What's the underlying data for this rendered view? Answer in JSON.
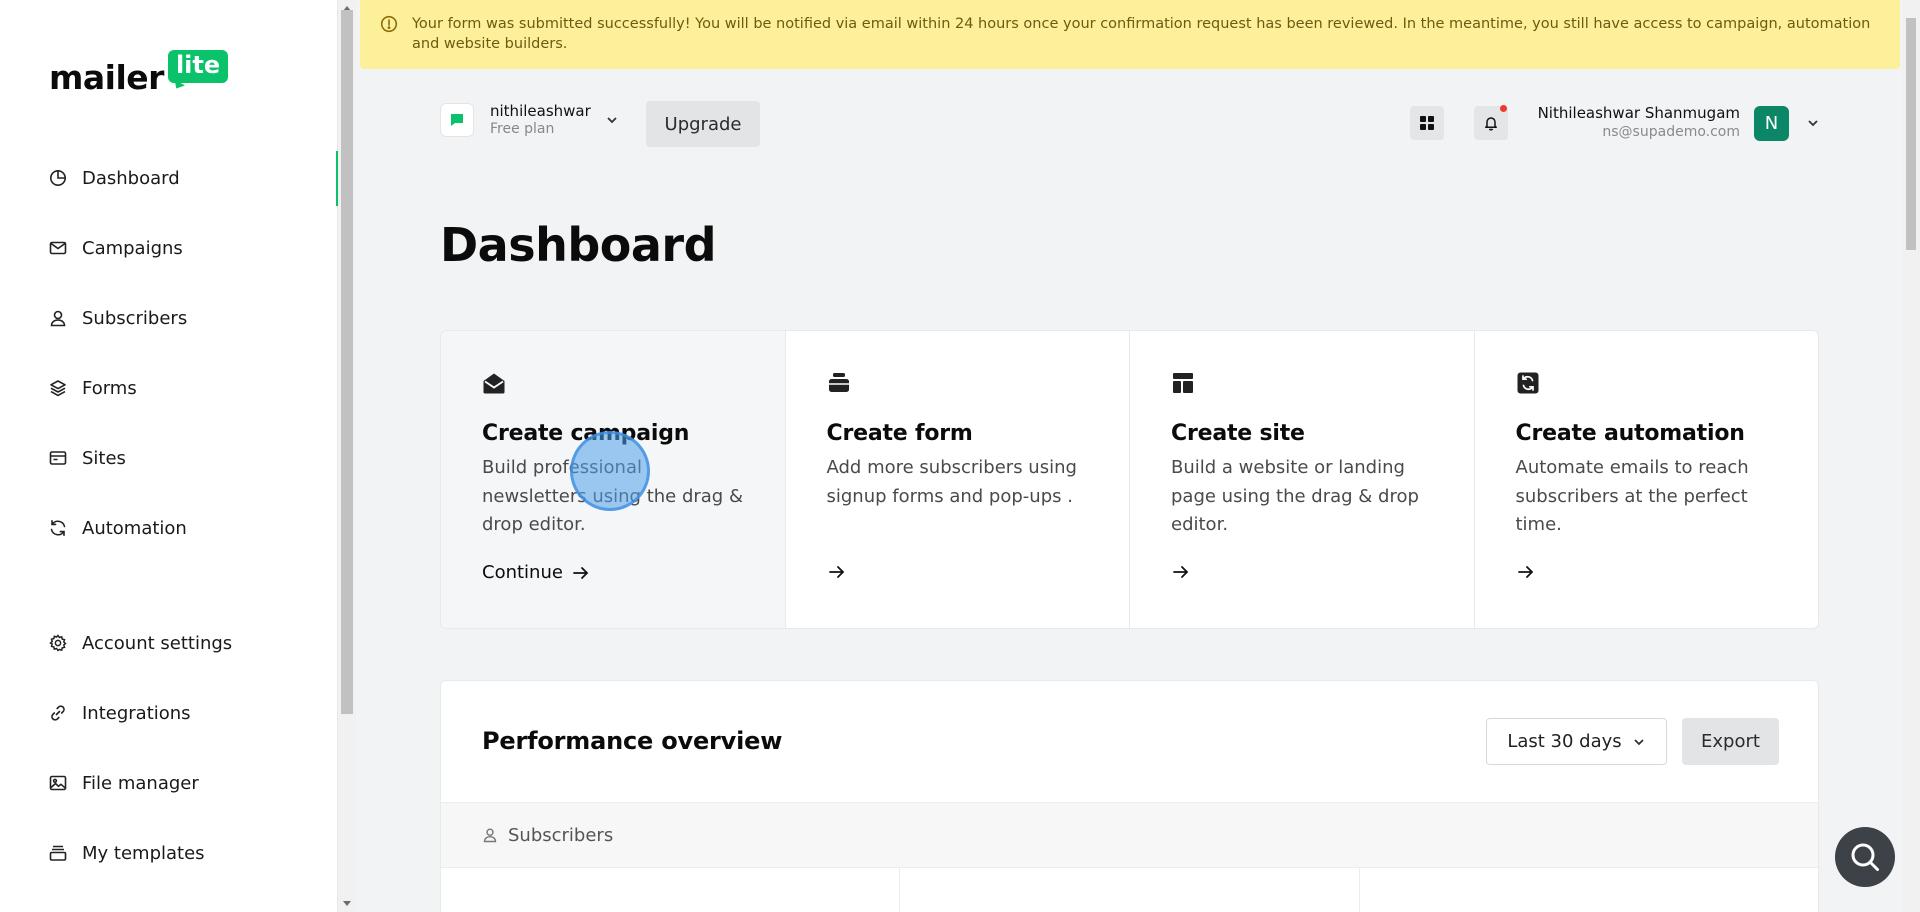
{
  "brand": {
    "word": "mailer",
    "badge": "lite",
    "accent": "#09c269"
  },
  "sidebar": {
    "items": [
      {
        "label": "Dashboard",
        "icon": "dashboard-icon",
        "active": true
      },
      {
        "label": "Campaigns",
        "icon": "envelope-icon"
      },
      {
        "label": "Subscribers",
        "icon": "user-icon"
      },
      {
        "label": "Forms",
        "icon": "layers-icon"
      },
      {
        "label": "Sites",
        "icon": "browser-icon"
      },
      {
        "label": "Automation",
        "icon": "refresh-icon"
      },
      {
        "label": "Account settings",
        "icon": "gear-icon"
      },
      {
        "label": "Integrations",
        "icon": "link-icon"
      },
      {
        "label": "File manager",
        "icon": "image-icon"
      },
      {
        "label": "My templates",
        "icon": "template-icon"
      }
    ]
  },
  "banner": {
    "text": "Your form was submitted successfully! You will be notified via email within 24 hours once your confirmation request has been reviewed. In the meantime, you still have access to campaign, automation and website builders.",
    "icon": "warning-circle-icon"
  },
  "header": {
    "account_name": "nithileashwar",
    "plan": "Free plan",
    "upgrade_label": "Upgrade",
    "user_name": "Nithileashwar Shanmugam",
    "user_email": "ns@supademo.com",
    "avatar_letter": "N"
  },
  "page": {
    "title": "Dashboard"
  },
  "cards": [
    {
      "title": "Create campaign",
      "desc": "Build professional newsletters using the drag & drop editor.",
      "cta": "Continue",
      "icon": "open-envelope-icon"
    },
    {
      "title": "Create form",
      "desc": "Add more subscribers using signup forms and pop-ups .",
      "cta": "",
      "icon": "form-stack-icon"
    },
    {
      "title": "Create site",
      "desc": "Build a website or landing page using the drag & drop editor.",
      "cta": "",
      "icon": "layout-icon"
    },
    {
      "title": "Create automation",
      "desc": "Automate emails to reach subscribers at the perfect time.",
      "cta": "",
      "icon": "automation-icon"
    }
  ],
  "performance": {
    "title": "Performance overview",
    "range": "Last 30 days",
    "export_label": "Export",
    "tab": "Subscribers"
  }
}
